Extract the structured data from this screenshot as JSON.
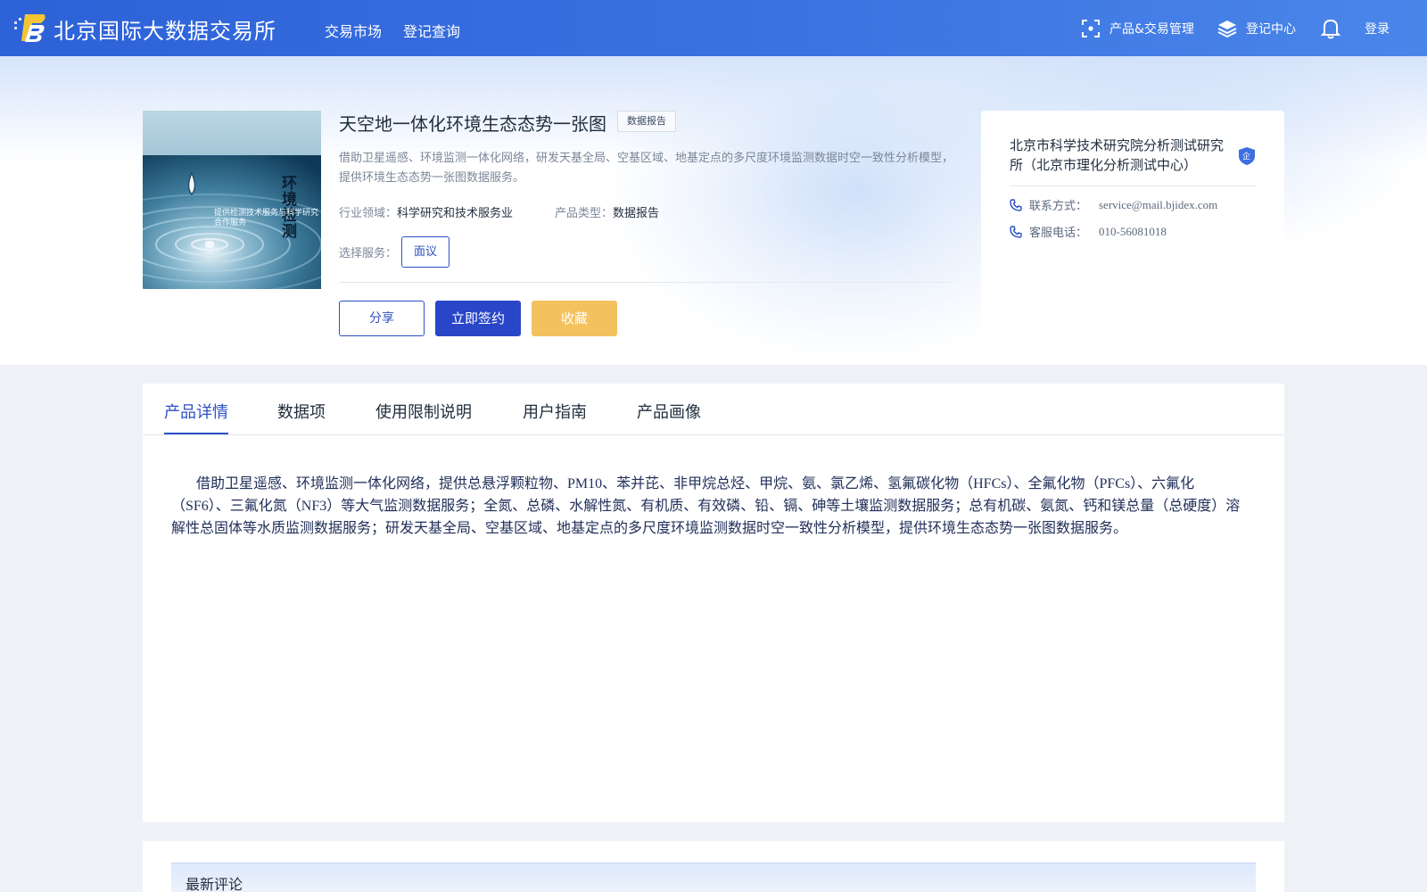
{
  "header": {
    "site_title": "北京国际大数据交易所",
    "nav": [
      "交易市场",
      "登记查询"
    ],
    "product_trade_label": "产品&交易管理",
    "registry_center_label": "登记中心",
    "login_label": "登录",
    "colors": {
      "bar_start": "#2d62d8",
      "bar_end": "#4a86ea"
    }
  },
  "product": {
    "title": "天空地一体化环境生态态势一张图",
    "badge": "数据报告",
    "description": "借助卫星遥感、环境监测一体化网络，研发天基全局、空基区域、地基定点的多尺度环境监测数据时空一致性分析模型，提供环境生态态势一张图数据服务。",
    "industry_label": "行业领域：",
    "industry_value": "科学研究和技术服务业",
    "type_label": "产品类型：",
    "type_value": "数据报告",
    "service_label": "选择服务：",
    "service_option": "面议",
    "image_caption_top": "环境检测",
    "image_caption_side": "提供检测技术服务与科学研究合作服务"
  },
  "actions": {
    "share": "分享",
    "sign": "立即签约",
    "favorite": "收藏"
  },
  "vendor": {
    "name": "北京市科学技术研究院分析测试研究所（北京市理化分析测试中心）",
    "badge_text": "企",
    "contact_label": "联系方式：",
    "contact_value": "service@mail.bjidex.com",
    "phone_label": "客服电话：",
    "phone_value": "010-56081018"
  },
  "tabs": [
    "产品详情",
    "数据项",
    "使用限制说明",
    "用户指南",
    "产品画像"
  ],
  "active_tab": "产品详情",
  "detail_text": "借助卫星遥感、环境监测一体化网络，提供总悬浮颗粒物、PM10、苯并芘、非甲烷总烃、甲烷、氨、氯乙烯、氢氟碳化物（HFCs）、全氟化物（PFCs）、六氟化（SF6）、三氟化氮（NF3）等大气监测数据服务；全氮、总磷、水解性氮、有机质、有效磷、铅、镉、砷等土壤监测数据服务；总有机碳、氨氮、钙和镁总量（总硬度）溶解性总固体等水质监测数据服务；研发天基全局、空基区域、地基定点的多尺度环境监测数据时空一致性分析模型，提供环境生态态势一张图数据服务。",
  "comments": {
    "title": "最新评论"
  },
  "icons": {
    "logo": "bjidex-logo-icon",
    "product_trade": "scan-frame-icon",
    "registry_center": "layers-icon",
    "notifications": "bell-icon",
    "contact": "phone-icon",
    "phone": "phone-icon",
    "vendor_badge": "shield-icon"
  }
}
